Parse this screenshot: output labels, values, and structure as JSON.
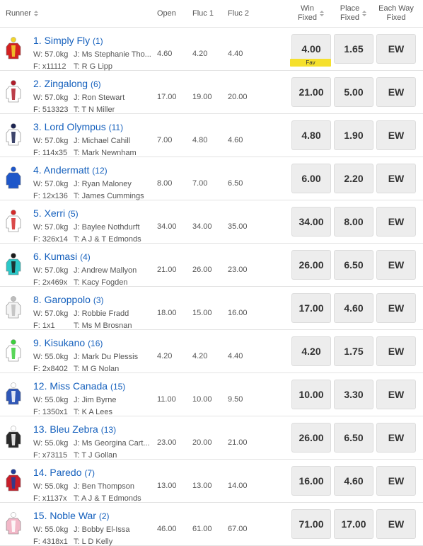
{
  "header": {
    "runner": "Runner",
    "open": "Open",
    "fluc1": "Fluc 1",
    "fluc2": "Fluc 2",
    "win_l1": "Win",
    "win_l2": "Fixed",
    "place_l1": "Place",
    "place_l2": "Fixed",
    "ew_l1": "Each Way",
    "ew_l2": "Fixed"
  },
  "fav_label": "Fav",
  "runners": [
    {
      "name": "1. Simply Fly",
      "barrier": "(1)",
      "weight": "W: 57.0kg",
      "jockey": "J: Ms Stephanie Tho...",
      "form": "F: x11112",
      "trainer": "T: R G Lipp",
      "open": "4.60",
      "fluc1": "4.20",
      "fluc2": "4.40",
      "win": "4.00",
      "place": "1.65",
      "ew": "EW",
      "silk": "silk-simply-fly",
      "c1": "#d42020",
      "c2": "#f2d52a"
    },
    {
      "name": "2. Zingalong",
      "barrier": "(6)",
      "weight": "W: 57.0kg",
      "jockey": "J: Ron Stewart",
      "form": "F: 513323",
      "trainer": "T: T N Miller",
      "open": "17.00",
      "fluc1": "19.00",
      "fluc2": "20.00",
      "win": "21.00",
      "place": "5.00",
      "ew": "EW",
      "silk": "silk-zingalong",
      "c1": "#ffffff",
      "c2": "#b01c2a"
    },
    {
      "name": "3. Lord Olympus",
      "barrier": "(11)",
      "weight": "W: 57.0kg",
      "jockey": "J: Michael Cahill",
      "form": "F: 114x35",
      "trainer": "T: Mark Newnham",
      "open": "7.00",
      "fluc1": "4.80",
      "fluc2": "4.60",
      "win": "4.80",
      "place": "1.90",
      "ew": "EW",
      "silk": "silk-lord-olympus",
      "c1": "#ffffff",
      "c2": "#1c2452"
    },
    {
      "name": "4. Andermatt",
      "barrier": "(12)",
      "weight": "W: 57.0kg",
      "jockey": "J: Ryan Maloney",
      "form": "F: 12x136",
      "trainer": "T: James Cummings",
      "open": "8.00",
      "fluc1": "7.00",
      "fluc2": "6.50",
      "win": "6.00",
      "place": "2.20",
      "ew": "EW",
      "silk": "silk-andermatt",
      "c1": "#1f57c9",
      "c2": "#1f57c9"
    },
    {
      "name": "5. Xerri",
      "barrier": "(5)",
      "weight": "W: 57.0kg",
      "jockey": "J: Baylee Nothdurft",
      "form": "F: 326x14",
      "trainer": "T: A J & T Edmonds",
      "open": "34.00",
      "fluc1": "34.00",
      "fluc2": "35.00",
      "win": "34.00",
      "place": "8.00",
      "ew": "EW",
      "silk": "silk-xerri",
      "c1": "#ffffff",
      "c2": "#d42a2a"
    },
    {
      "name": "6. Kumasi",
      "barrier": "(4)",
      "weight": "W: 57.0kg",
      "jockey": "J: Andrew Mallyon",
      "form": "F: 2x469x",
      "trainer": "T: Kacy Fogden",
      "open": "21.00",
      "fluc1": "26.00",
      "fluc2": "23.00",
      "win": "26.00",
      "place": "6.50",
      "ew": "EW",
      "silk": "silk-kumasi",
      "c1": "#2bc8c8",
      "c2": "#1a1a1a"
    },
    {
      "name": "8. Garoppolo",
      "barrier": "(3)",
      "weight": "W: 57.0kg",
      "jockey": "J: Robbie Fradd",
      "form": "F: 1x1",
      "trainer": "T: Ms M Brosnan",
      "open": "18.00",
      "fluc1": "15.00",
      "fluc2": "16.00",
      "win": "17.00",
      "place": "4.60",
      "ew": "EW",
      "silk": "silk-garoppolo",
      "c1": "#f4f4f4",
      "c2": "#bdbdbd"
    },
    {
      "name": "9. Kisukano",
      "barrier": "(16)",
      "weight": "W: 55.0kg",
      "jockey": "J: Mark Du Plessis",
      "form": "F: 2x8402",
      "trainer": "T: M G Nolan",
      "open": "4.20",
      "fluc1": "4.20",
      "fluc2": "4.40",
      "win": "4.20",
      "place": "1.75",
      "ew": "EW",
      "silk": "silk-kisukano",
      "c1": "#ffffff",
      "c2": "#3ccf3c"
    },
    {
      "name": "12. Miss Canada",
      "barrier": "(15)",
      "weight": "W: 55.0kg",
      "jockey": "J: Jim Byrne",
      "form": "F: 1350x1",
      "trainer": "T: K A Lees",
      "open": "11.00",
      "fluc1": "10.00",
      "fluc2": "9.50",
      "win": "10.00",
      "place": "3.30",
      "ew": "EW",
      "silk": "silk-miss-canada",
      "c1": "#2f57b8",
      "c2": "#ffffff"
    },
    {
      "name": "13. Bleu Zebra",
      "barrier": "(13)",
      "weight": "W: 55.0kg",
      "jockey": "J: Ms Georgina Cart...",
      "form": "F: x73115",
      "trainer": "T: T J Gollan",
      "open": "23.00",
      "fluc1": "20.00",
      "fluc2": "21.00",
      "win": "26.00",
      "place": "6.50",
      "ew": "EW",
      "silk": "silk-bleu-zebra",
      "c1": "#2a2a2a",
      "c2": "#ffffff"
    },
    {
      "name": "14. Paredo",
      "barrier": "(7)",
      "weight": "W: 55.0kg",
      "jockey": "J: Ben Thompson",
      "form": "F: x1137x",
      "trainer": "T: A J & T Edmonds",
      "open": "13.00",
      "fluc1": "13.00",
      "fluc2": "14.00",
      "win": "16.00",
      "place": "4.60",
      "ew": "EW",
      "silk": "silk-paredo",
      "c1": "#c81e2a",
      "c2": "#1f3d99"
    },
    {
      "name": "15. Noble War",
      "barrier": "(2)",
      "weight": "W: 55.0kg",
      "jockey": "J: Bobby El-Issa",
      "form": "F: 4318x1",
      "trainer": "T: L D Kelly",
      "open": "46.00",
      "fluc1": "61.00",
      "fluc2": "67.00",
      "win": "71.00",
      "place": "17.00",
      "ew": "EW",
      "silk": "silk-noble-war",
      "c1": "#f2b8c8",
      "c2": "#ffffff"
    }
  ]
}
